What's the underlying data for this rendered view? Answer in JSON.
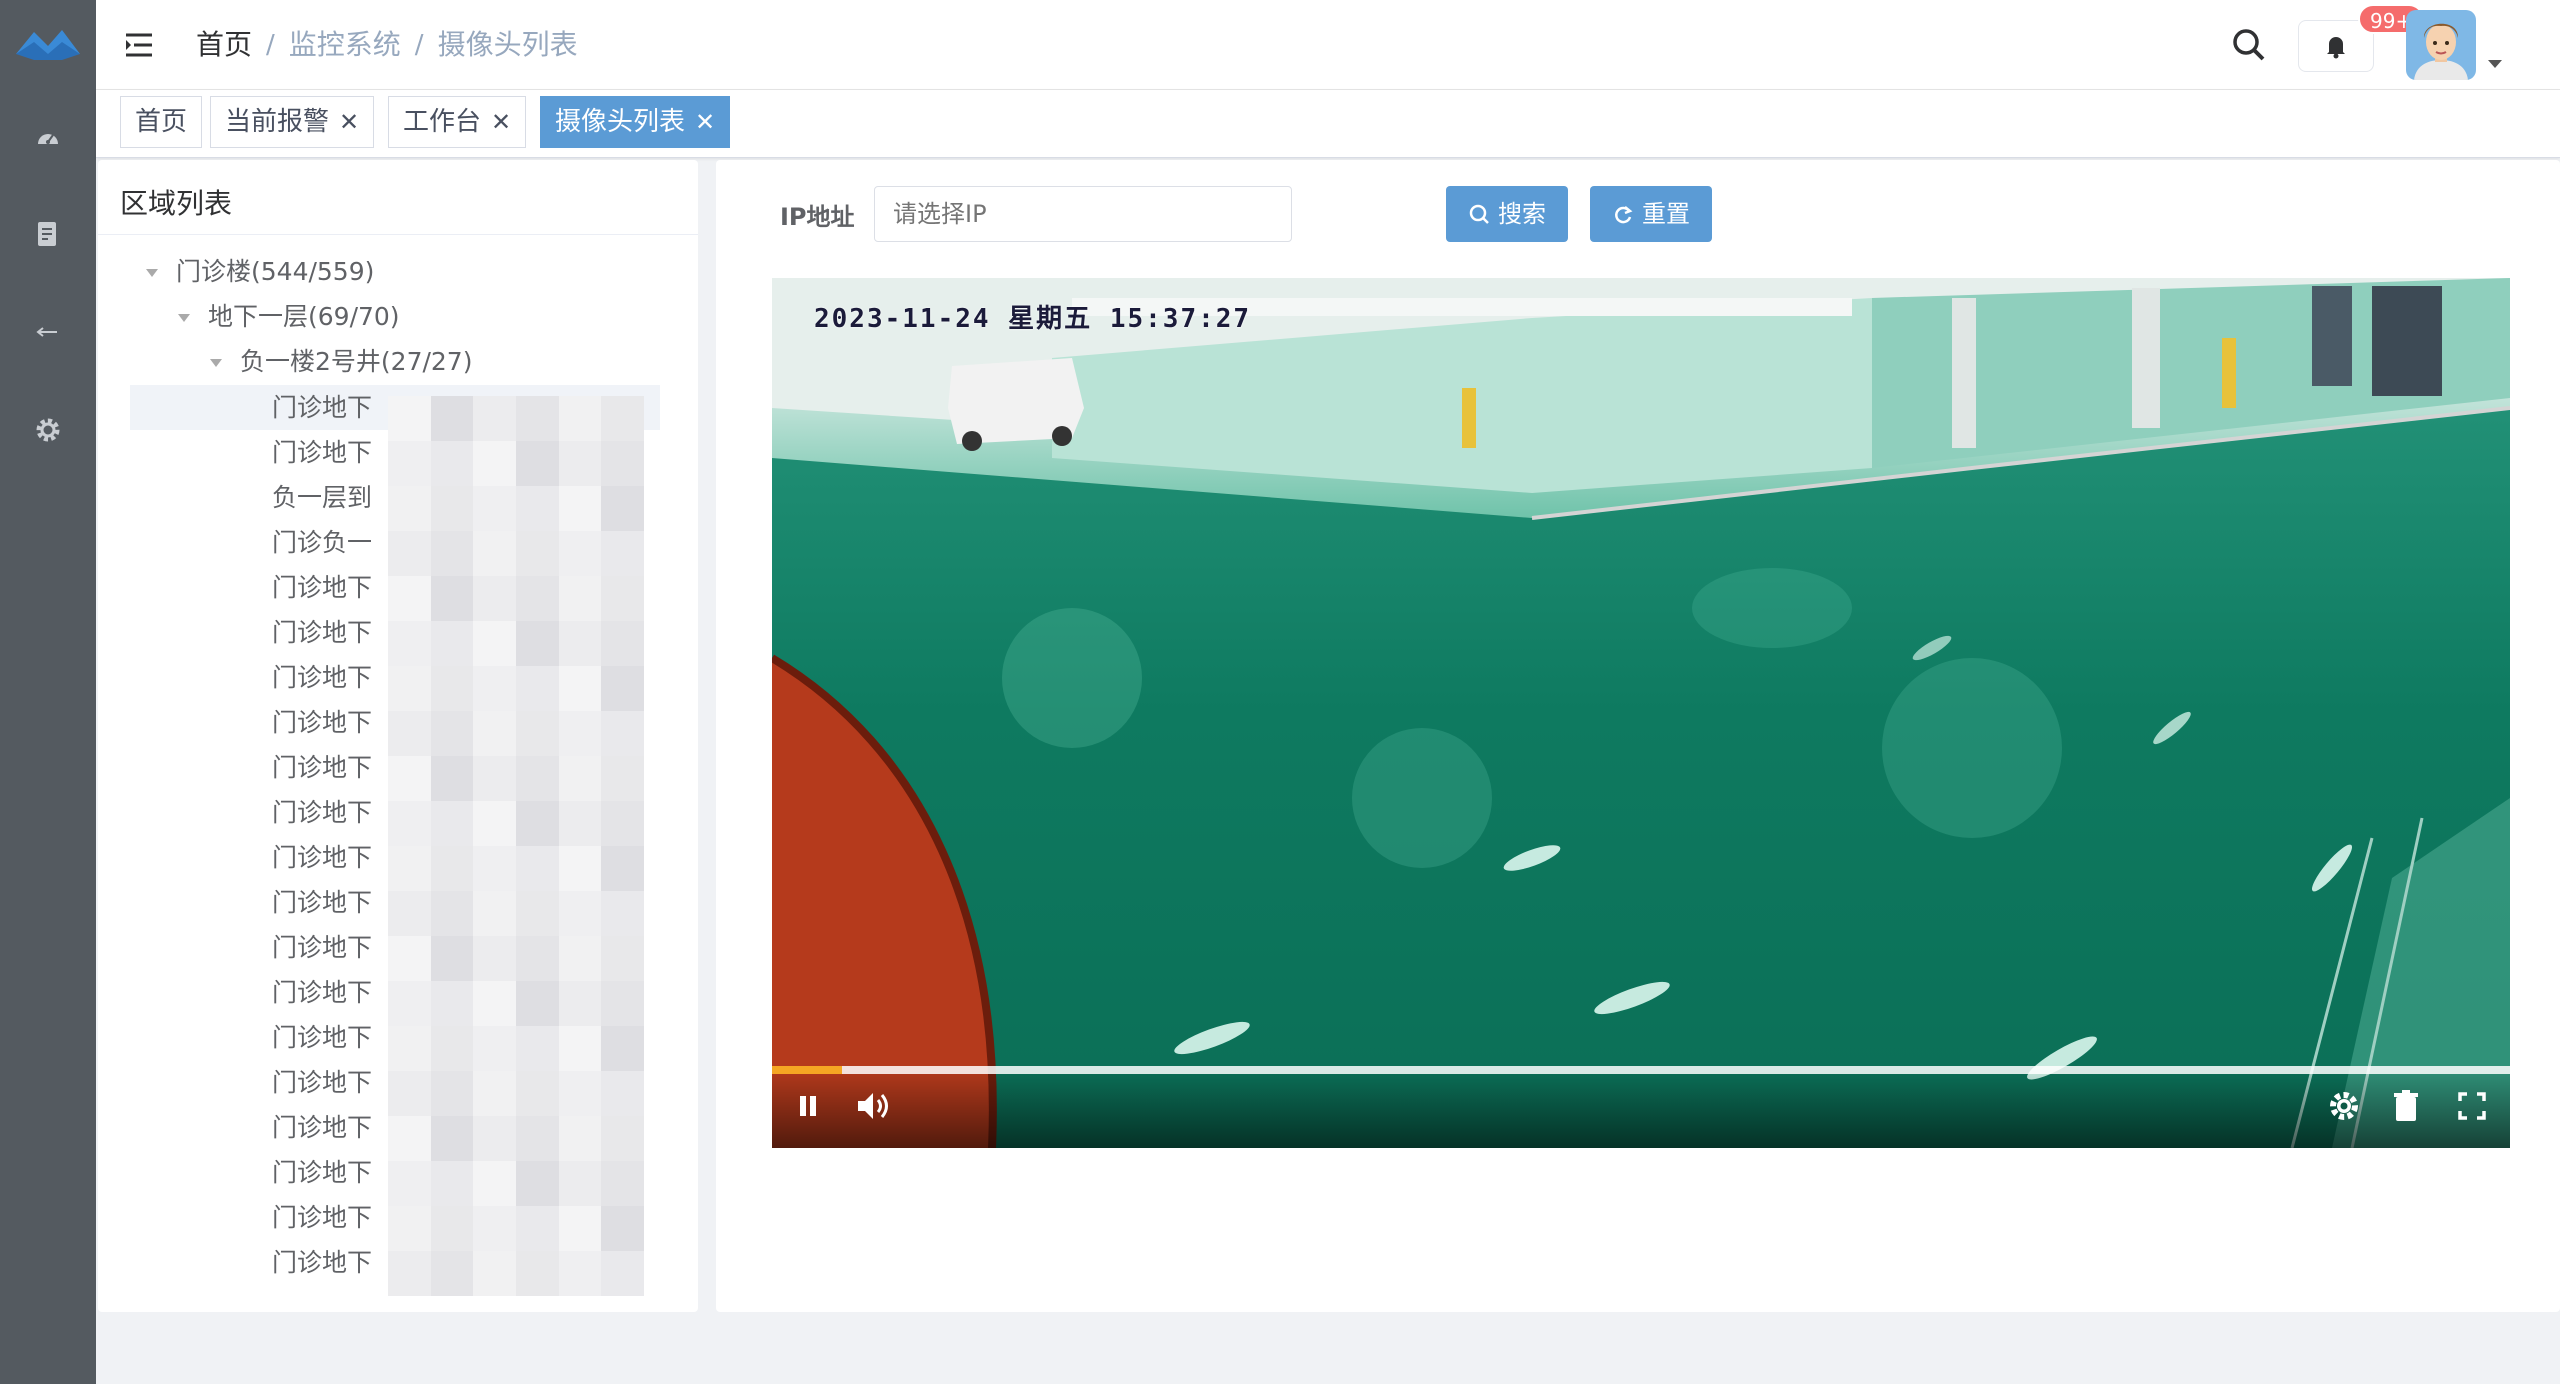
{
  "header": {
    "breadcrumb": [
      "首页",
      "监控系统",
      "摄像头列表"
    ],
    "notification_badge": "99+"
  },
  "tags": [
    {
      "label": "首页",
      "closable": false,
      "active": false
    },
    {
      "label": "当前报警",
      "closable": true,
      "active": false
    },
    {
      "label": "工作台",
      "closable": true,
      "active": false
    },
    {
      "label": "摄像头列表",
      "closable": true,
      "active": true
    }
  ],
  "sidebar": {
    "icons": [
      "logo-icon",
      "dashboard-icon",
      "document-icon",
      "arrow-icon",
      "gear-icon"
    ]
  },
  "area_panel": {
    "title": "区域列表",
    "tree": {
      "level1": "门诊楼(544/559)",
      "level2": "地下一层(69/70)",
      "level3": "负一楼2号井(27/27)",
      "leaves": [
        "门诊地下",
        "门诊地下",
        "负一层到",
        "门诊负一",
        "门诊地下",
        "门诊地下",
        "门诊地下",
        "门诊地下",
        "门诊地下",
        "门诊地下",
        "门诊地下",
        "门诊地下",
        "门诊地下",
        "门诊地下",
        "门诊地下",
        "门诊地下",
        "门诊地下",
        "门诊地下",
        "门诊地下",
        "门诊地下"
      ]
    }
  },
  "search": {
    "label": "IP地址",
    "placeholder": "请选择IP",
    "search_button": "搜索",
    "reset_button": "重置"
  },
  "video": {
    "timestamp": "2023-11-24 星期五 15:37:27",
    "progress": 0.004,
    "state": "playing"
  },
  "colors": {
    "sidebar": "#545a60",
    "primary": "#5b9bd5",
    "badge": "#f56c6c",
    "floor": "#0f7d63"
  }
}
